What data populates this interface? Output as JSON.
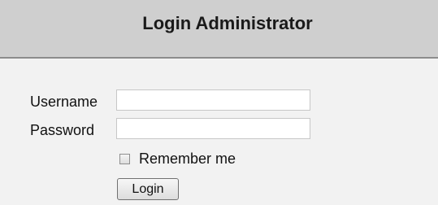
{
  "header": {
    "title": "Login Administrator"
  },
  "form": {
    "username_label": "Username",
    "username_value": "",
    "password_label": "Password",
    "password_value": "",
    "remember_label": "Remember me",
    "remember_checked": false,
    "login_label": "Login"
  },
  "colors": {
    "header_bg": "#cfcfcf",
    "page_bg": "#f2f2f2",
    "divider": "#8c8c8c"
  }
}
